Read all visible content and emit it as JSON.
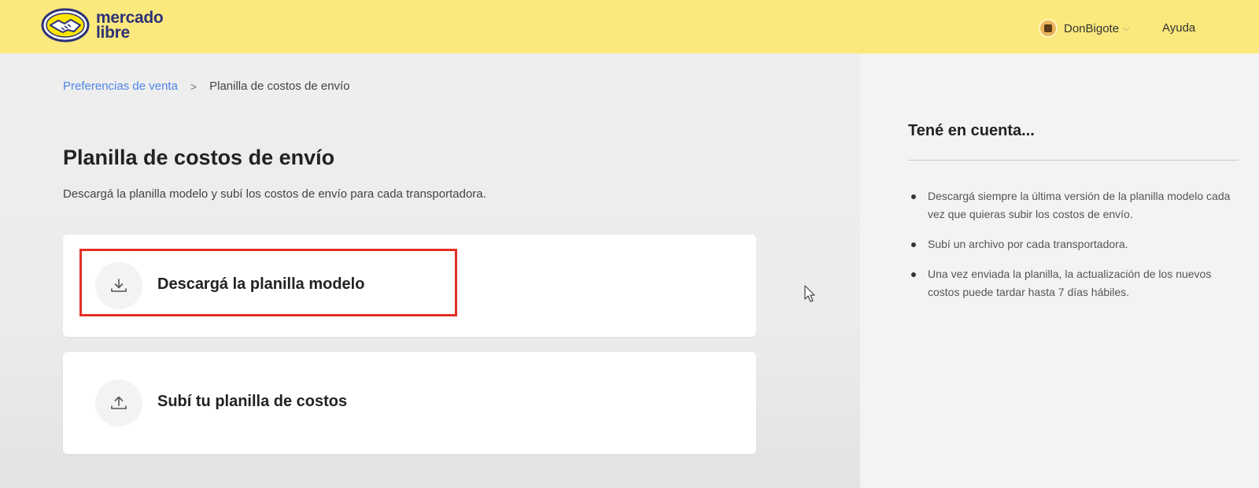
{
  "header": {
    "logo_text_line1": "mercado",
    "logo_text_line2": "libre",
    "user_name": "DonBigote",
    "help_label": "Ayuda"
  },
  "breadcrumb": {
    "parent": "Preferencias de venta",
    "separator": ">",
    "current": "Planilla de costos de envío"
  },
  "main": {
    "title": "Planilla de costos de envío",
    "description": "Descargá la planilla modelo y subí los costos de envío para cada transportadora.",
    "cards": [
      {
        "label": "Descargá la planilla modelo",
        "icon": "download-icon"
      },
      {
        "label": "Subí tu planilla de costos",
        "icon": "upload-icon"
      }
    ]
  },
  "sidebar": {
    "title": "Tené en cuenta...",
    "notes": [
      "Descargá siempre la última versión de la planilla modelo cada vez que quieras subir los costos de envío.",
      "Subí un archivo por cada transportadora.",
      "Una vez enviada la planilla, la actualización de los nuevos costos puede tardar hasta 7 días hábiles."
    ]
  },
  "colors": {
    "header_bg": "#fbe97d",
    "link": "#4f86e8",
    "highlight": "#e32f24",
    "logo": "#2d3277"
  }
}
